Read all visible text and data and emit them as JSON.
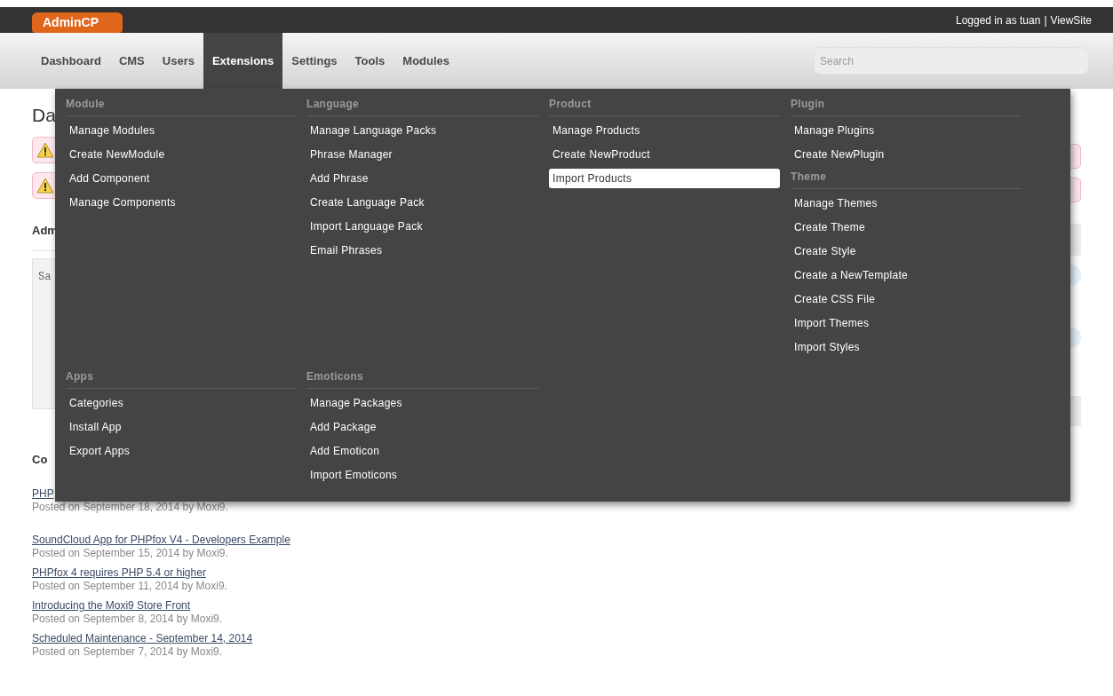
{
  "top_bar": {
    "logo": "AdminCP",
    "account_label": "Logged in as tuan",
    "separator": "|",
    "account_link": "ViewSite"
  },
  "nav": [
    {
      "label": "Dashboard",
      "selected": false
    },
    {
      "label": "CMS",
      "selected": false
    },
    {
      "label": "Users",
      "selected": false
    },
    {
      "label": "Extensions",
      "selected": true
    },
    {
      "label": "Settings",
      "selected": false
    },
    {
      "label": "Tools",
      "selected": false
    },
    {
      "label": "Modules",
      "selected": false
    }
  ],
  "search": {
    "placeholder": "Search"
  },
  "mega_menu": {
    "top_row": [
      {
        "sections": [
          {
            "heading": "Module",
            "items": [
              {
                "label": "Manage Modules",
                "selected": false
              },
              {
                "label": "Create NewModule",
                "selected": false
              },
              {
                "label": "Add Component",
                "selected": false
              },
              {
                "label": "Manage Components",
                "selected": false
              }
            ]
          }
        ]
      },
      {
        "sections": [
          {
            "heading": "Language",
            "items": [
              {
                "label": "Manage Language Packs",
                "selected": false
              },
              {
                "label": "Phrase Manager",
                "selected": false
              },
              {
                "label": "Add Phrase",
                "selected": false
              },
              {
                "label": "Create Language Pack",
                "selected": false
              },
              {
                "label": "Import Language Pack",
                "selected": false
              },
              {
                "label": "Email Phrases",
                "selected": false
              }
            ]
          }
        ]
      },
      {
        "sections": [
          {
            "heading": "Product",
            "items": [
              {
                "label": "Manage Products",
                "selected": false
              },
              {
                "label": "Create NewProduct",
                "selected": false
              },
              {
                "label": "Import Products",
                "selected": true
              }
            ]
          }
        ]
      },
      {
        "sections": [
          {
            "heading": "Plugin",
            "items": [
              {
                "label": "Manage Plugins",
                "selected": false
              },
              {
                "label": "Create NewPlugin",
                "selected": false
              }
            ]
          },
          {
            "heading": "Theme",
            "items": [
              {
                "label": "Manage Themes",
                "selected": false
              },
              {
                "label": "Create Theme",
                "selected": false
              },
              {
                "label": "Create Style",
                "selected": false
              },
              {
                "label": "Create a NewTemplate",
                "selected": false
              },
              {
                "label": "Create CSS File",
                "selected": false
              },
              {
                "label": "Import Themes",
                "selected": false
              },
              {
                "label": "Import Styles",
                "selected": false
              }
            ]
          }
        ]
      }
    ],
    "bottom_row": [
      {
        "sections": [
          {
            "heading": "Apps",
            "items": [
              {
                "label": "Categories",
                "selected": false
              },
              {
                "label": "Install App",
                "selected": false
              },
              {
                "label": "Export Apps",
                "selected": false
              }
            ]
          }
        ]
      },
      {
        "sections": [
          {
            "heading": "Emoticons",
            "items": [
              {
                "label": "Manage Packages",
                "selected": false
              },
              {
                "label": "Add Package",
                "selected": false
              },
              {
                "label": "Add Emoticon",
                "selected": false
              },
              {
                "label": "Import Emoticons",
                "selected": false
              }
            ]
          }
        ]
      }
    ]
  },
  "page": {
    "heading": "Da",
    "notes_heading": "Adm",
    "notes_placeholder": "Sa",
    "news_heading": "Co",
    "news": [
      {
        "title": "PHP",
        "posted": "Posted on September 18, 2014 by Moxi9."
      },
      {
        "title": "SoundCloud App for PHPfox V4 - Developers Example",
        "posted": "Posted on September 15, 2014 by Moxi9."
      },
      {
        "title": "PHPfox 4 requires PHP 5.4 or higher",
        "posted": "Posted on September 11, 2014 by Moxi9."
      },
      {
        "title": "Introducing the Moxi9 Store Front",
        "posted": "Posted on September 8, 2014 by Moxi9."
      },
      {
        "title": "Scheduled Maintenance - September 14, 2014",
        "posted": "Posted on September 7, 2014 by Moxi9."
      }
    ]
  }
}
